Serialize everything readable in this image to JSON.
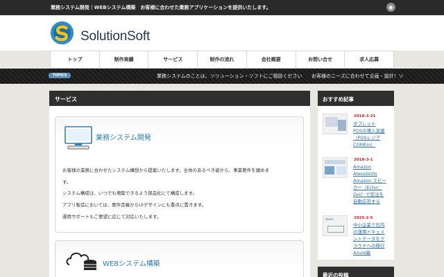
{
  "topbar": {
    "tagline": "業務システム開発｜WEBシステム構築　お客様に合わせた業務アプリケーションを提供いたします。",
    "rss_icon": "rss-icon"
  },
  "header": {
    "logo_icon": "solutionsoft-logo",
    "logo_text": "SolutionSoft"
  },
  "nav": {
    "items": [
      "トップ",
      "制作実績",
      "サービス",
      "制作の流れ",
      "会社概要",
      "お問い合せ",
      "求人応募"
    ]
  },
  "ticker": {
    "badge": "TOPICS",
    "message1": "業務システムのことは、ソリューション・ソフトにご相談ください",
    "message2": "お客様のニーズに合わせて企画・設計！ソ"
  },
  "main": {
    "title": "サービス",
    "cards": [
      {
        "heading": "業務システム開発",
        "icon": "monitor-icon",
        "paragraphs": [
          "お客様の業務に合わせたシステム構想から提案いたします。全体のあるべき姿から、事業要件を纏めま",
          "す。",
          "システム構成は、いつでも増築できるよう部品化にて構成します。",
          "アプリ製造においては、要件定義からUIデザインにも重点に置きます。",
          "運用サポートもご要望に応じて対応いたします。"
        ]
      },
      {
        "heading": "WEBシステム構築",
        "icon": "cloud-database-icon"
      }
    ]
  },
  "sidebar": {
    "recommended_title": "おすすめ記事",
    "posts": [
      {
        "date": "2018-3-21",
        "lines": [
          "タブレット",
          "POSの導入支援",
          "（POSレジア",
          "COMEin）"
        ]
      },
      {
        "date": "2018-3-1",
        "lines": [
          "Amazon",
          "AlexaSkills",
          "Amazon スピー",
          "カー（Echo：",
          "Dot）で受注を",
          "自動応答する"
        ]
      },
      {
        "date": "2025-2-5",
        "lines": [
          "中小企業で社内",
          "の運用ドキュメ",
          "ントデータをク",
          "ラウドへの移行",
          "Azure編"
        ]
      }
    ],
    "recent_title": "最近の投稿"
  }
}
